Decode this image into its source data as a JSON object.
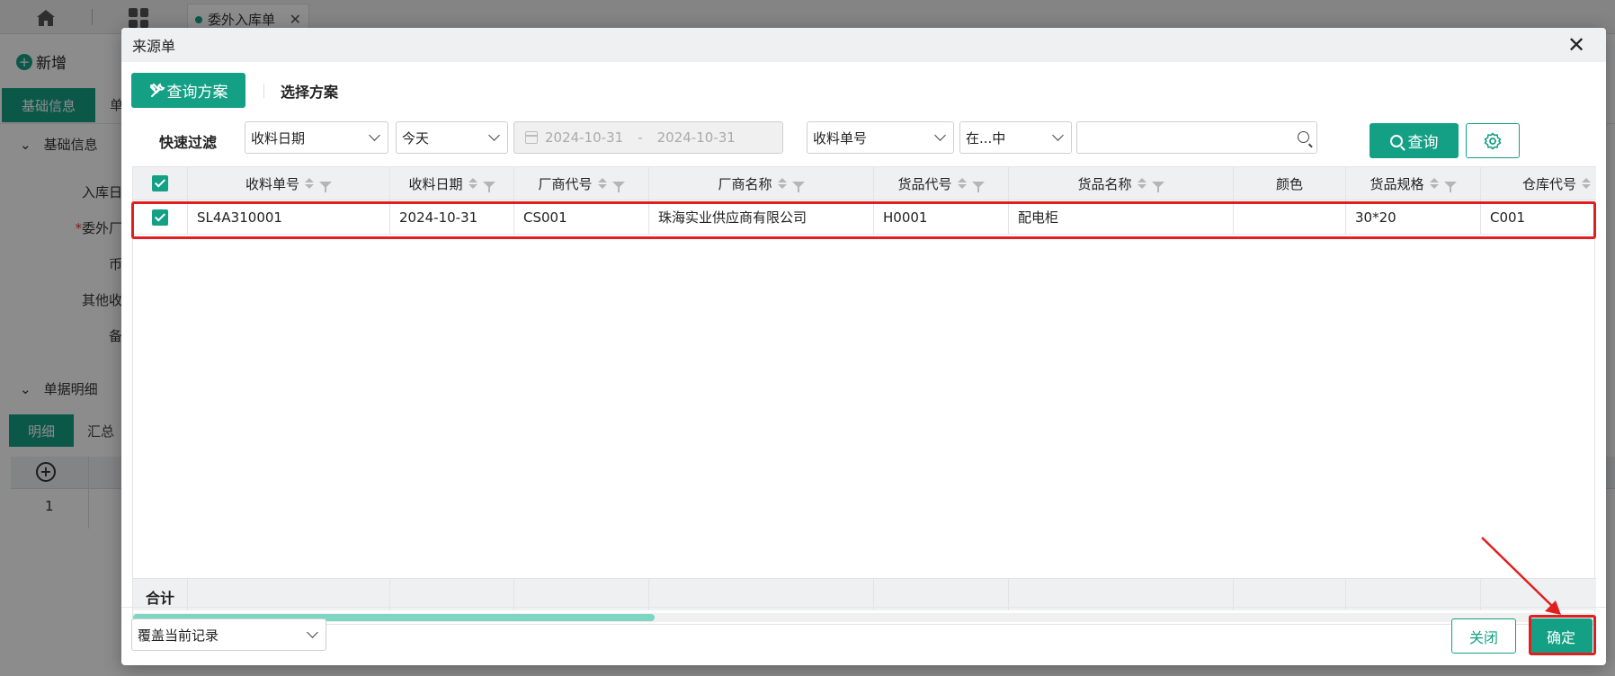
{
  "background": {
    "tab_label": "委外入库单",
    "new_label": "新增",
    "tab_basic": "基础信息",
    "tab_second": "单",
    "section_basic": "基础信息",
    "labels": [
      "入库日",
      "委外厂",
      "币",
      "其他收",
      "备"
    ],
    "section_detail": "单据明细",
    "minitab_detail": "明细",
    "minitab_summary": "汇总",
    "row_number": "1"
  },
  "modal": {
    "title": "来源单",
    "query_scheme_label": "查询方案",
    "choose_scheme_label": "选择方案",
    "quick_filter_label": "快速过滤",
    "filter_field_1": "收料日期",
    "filter_period": "今天",
    "date_start": "2024-10-31",
    "date_sep": "-",
    "date_end": "2024-10-31",
    "filter_field_2": "收料单号",
    "filter_operator": "在...中",
    "search_value": "",
    "query_button": "查询",
    "columns": [
      "收料单号",
      "收料日期",
      "厂商代号",
      "厂商名称",
      "货品代号",
      "货品名称",
      "颜色",
      "货品规格",
      "仓库代号"
    ],
    "rows": [
      {
        "checked": true,
        "cells": [
          "SL4A310001",
          "2024-10-31",
          "CS001",
          "珠海实业供应商有限公司",
          "H0001",
          "配电柜",
          "",
          "30*20",
          "C001"
        ]
      }
    ],
    "total_label": "合计",
    "mode_select": "覆盖当前记录",
    "close_button": "关闭",
    "ok_button": "确定"
  },
  "colors": {
    "accent": "#14a085",
    "highlight": "#e02020"
  }
}
